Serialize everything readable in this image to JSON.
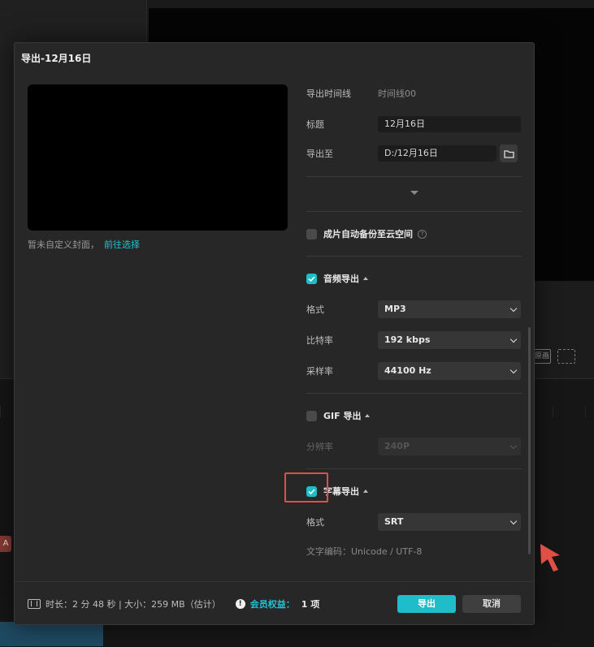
{
  "dialog": {
    "title": "导出-12月16日",
    "cover_text": "暂未自定义封面，",
    "cover_link": "前往选择",
    "fields": {
      "timeline_label": "导出时间线",
      "timeline_value": "时间线00",
      "title_label": "标题",
      "title_value": "12月16日",
      "export_to_label": "导出至",
      "export_to_value": "D:/12月16日"
    },
    "cloud_backup": {
      "label": "成片自动备份至云空间",
      "checked": false,
      "help_icon": "question-circle-icon"
    },
    "audio": {
      "label": "音频导出",
      "checked": true,
      "format_label": "格式",
      "format_value": "MP3",
      "bitrate_label": "比特率",
      "bitrate_value": "192 kbps",
      "samplerate_label": "采样率",
      "samplerate_value": "44100 Hz"
    },
    "gif": {
      "label": "GIF 导出",
      "checked": false,
      "resolution_label": "分辨率",
      "resolution_value": "240P"
    },
    "subtitle": {
      "label": "字幕导出",
      "checked": true,
      "format_label": "格式",
      "format_value": "SRT",
      "encoding_text": "文字编码：Unicode / UTF-8"
    },
    "footer": {
      "info": "时长：2 分 48 秒 | 大小：259 MB（估计）",
      "member_label": "会员权益：",
      "member_count": "1 项",
      "export_button": "导出",
      "cancel_button": "取消"
    }
  },
  "background": {
    "badge": "A",
    "toolbar_icon_label": "原画"
  },
  "colors": {
    "accent": "#1fbcca",
    "highlight": "#e04f45",
    "dialog_bg": "#272727"
  }
}
